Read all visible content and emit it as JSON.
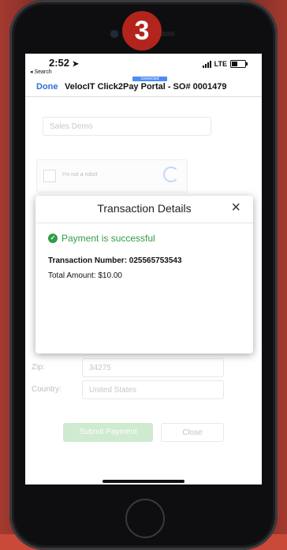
{
  "step_badge": "3",
  "status": {
    "time": "2:52",
    "back_label": "◂ Search",
    "network": "LTE"
  },
  "nav": {
    "connected_label": "connected",
    "done_label": "Done",
    "title": "VelocIT Click2Pay Portal - SO# 0001479"
  },
  "background_form": {
    "terminal_select": "Sales Demo",
    "captcha_label": "I'm not a robot",
    "zip_label": "Zip:",
    "zip_value": "34275",
    "country_label": "Country:",
    "country_value": "United States",
    "submit_label": "Submit Payment",
    "close_label": "Close"
  },
  "modal": {
    "title": "Transaction Details",
    "close_icon": "×",
    "success_message": "Payment is successful",
    "transaction_number_label": "Transaction Number: 025565753543",
    "total_amount_label": "Total Amount: $10.00"
  },
  "colors": {
    "accent": "#2f6fd6",
    "success": "#2e9e47",
    "badge": "#b3241c"
  }
}
